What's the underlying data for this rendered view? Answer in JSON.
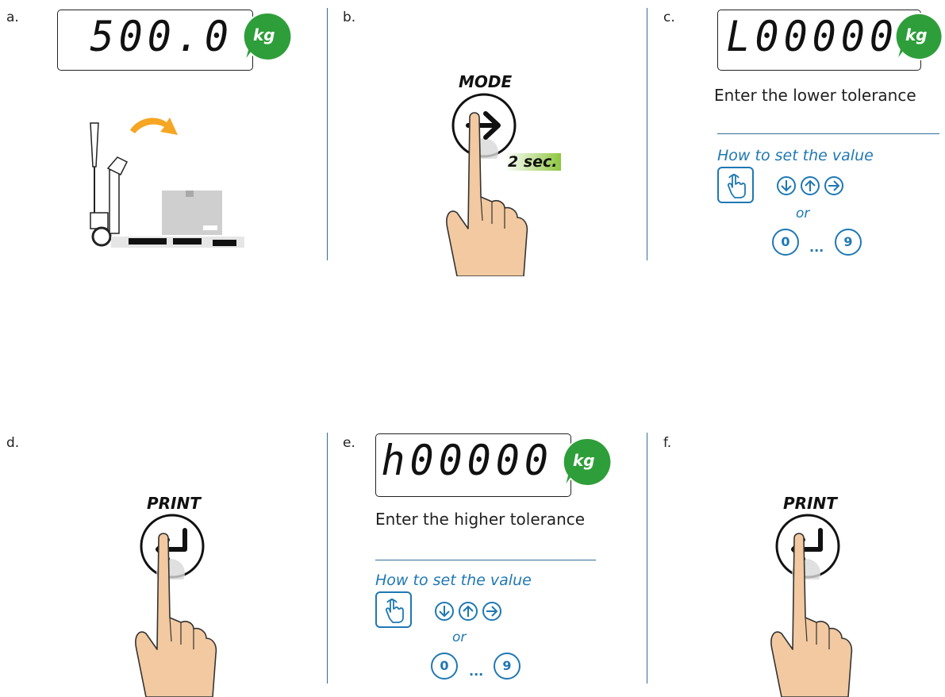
{
  "steps": {
    "a": {
      "letter": "a.",
      "display": "500.0",
      "unit": "kg"
    },
    "b": {
      "letter": "b.",
      "key": "MODE",
      "hold": "2 sec."
    },
    "c": {
      "letter": "c.",
      "display": "L00000",
      "unit": "kg",
      "caption": "Enter the lower tolerance",
      "howto": "How to set the value",
      "or": "or",
      "key0": "0",
      "key9": "9",
      "dots": "..."
    },
    "d": {
      "letter": "d.",
      "key": "PRINT"
    },
    "e": {
      "letter": "e.",
      "display": "h00000",
      "unit": "kg",
      "caption": "Enter the higher tolerance",
      "howto": "How to set the value",
      "or": "or",
      "key0": "0",
      "key9": "9",
      "dots": "..."
    },
    "f": {
      "letter": "f.",
      "key": "PRINT"
    }
  },
  "colors": {
    "accent": "#1f78b4",
    "kg_bubble": "#2e9e3a",
    "arrow": "#f5a623",
    "finger": "#f2c9a0",
    "box": "#cfcfcf"
  },
  "icons": [
    "kg-bubble-icon",
    "pallet-truck-icon",
    "curved-arrow-icon",
    "arrow-right-icon",
    "enter-icon",
    "hand-press-icon",
    "touch-icon",
    "arrow-down-icon",
    "arrow-up-icon"
  ]
}
